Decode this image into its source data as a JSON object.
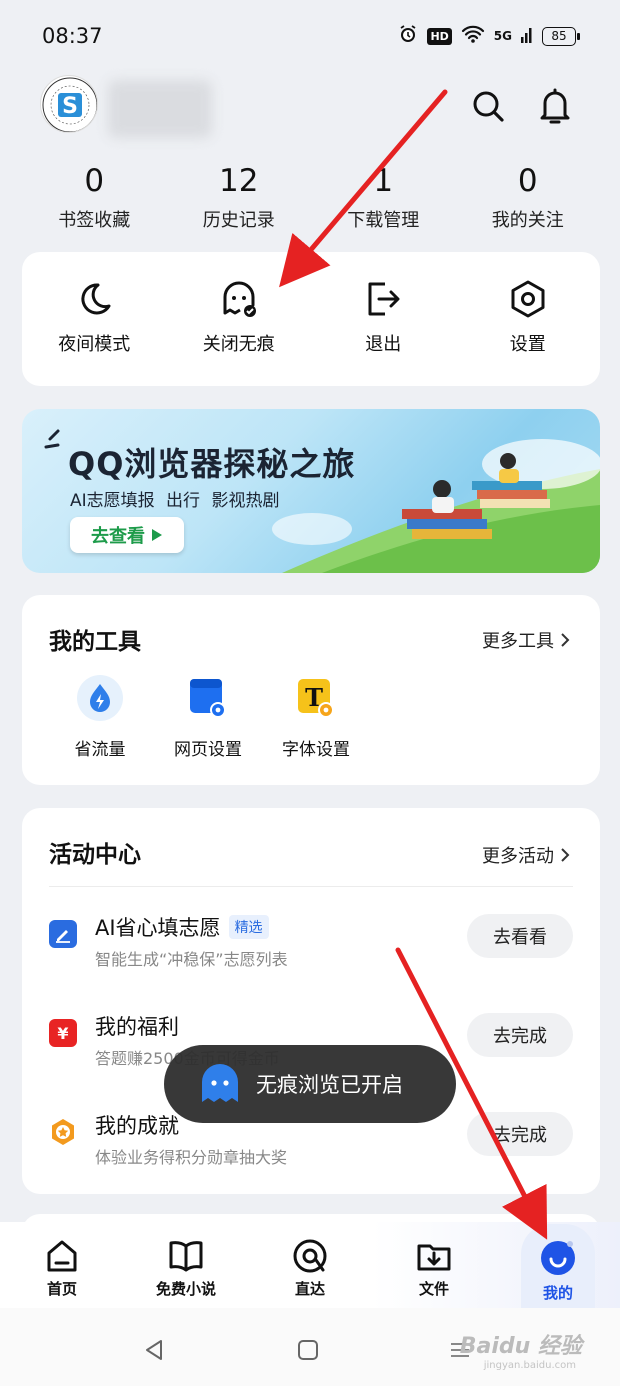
{
  "status_bar": {
    "time": "08:37",
    "hd": "HD",
    "network": "5G",
    "battery": "85"
  },
  "profile": {
    "avatar_icon": "site-logo-avatar",
    "username_hidden": true
  },
  "stats": [
    {
      "num": "0",
      "label": "书签收藏"
    },
    {
      "num": "12",
      "label": "历史记录"
    },
    {
      "num": "1",
      "label": "下载管理"
    },
    {
      "num": "0",
      "label": "我的关注"
    }
  ],
  "quick_actions": [
    {
      "label": "夜间模式",
      "icon": "moon-icon"
    },
    {
      "label": "关闭无痕",
      "icon": "ghost-icon"
    },
    {
      "label": "退出",
      "icon": "logout-icon"
    },
    {
      "label": "设置",
      "icon": "settings-icon"
    }
  ],
  "banner": {
    "title": "QQ浏览器探秘之旅",
    "subtitle": "AI志愿填报 出行 影视热剧",
    "button": "去查看"
  },
  "tools": {
    "title": "我的工具",
    "more": "更多工具",
    "items": [
      {
        "label": "省流量",
        "icon": "data-saver-icon"
      },
      {
        "label": "网页设置",
        "icon": "webpage-settings-icon"
      },
      {
        "label": "字体设置",
        "icon": "font-settings-icon"
      }
    ]
  },
  "activity": {
    "title": "活动中心",
    "more": "更多活动",
    "items": [
      {
        "title": "AI省心填志愿",
        "tag": "精选",
        "sub": "智能生成“冲稳保”志愿列表",
        "button": "去看看",
        "icon": "edit-icon"
      },
      {
        "title": "我的福利",
        "tag": "",
        "sub": "答题赚2500金币可得金币",
        "button": "去完成",
        "icon": "yuan-icon"
      },
      {
        "title": "我的成就",
        "tag": "",
        "sub": "体验业务得积分勋章抽大奖",
        "button": "去完成",
        "icon": "medal-icon"
      }
    ]
  },
  "toast": {
    "text": "无痕浏览已开启"
  },
  "tabbar": [
    {
      "label": "首页",
      "icon": "home-icon",
      "active": false
    },
    {
      "label": "免费小说",
      "icon": "book-icon",
      "active": false
    },
    {
      "label": "直达",
      "icon": "direct-icon",
      "active": false
    },
    {
      "label": "文件",
      "icon": "folder-download-icon",
      "active": false
    },
    {
      "label": "我的",
      "icon": "profile-icon",
      "active": true
    }
  ],
  "watermark": {
    "text": "Baidu 经验",
    "sub": "jingyan.baidu.com"
  },
  "colors": {
    "accent": "#1f54e6",
    "annotation_arrow": "#e52222",
    "toast_bg": "#2d2d2d",
    "tag_blue": "#2a6ce0"
  }
}
